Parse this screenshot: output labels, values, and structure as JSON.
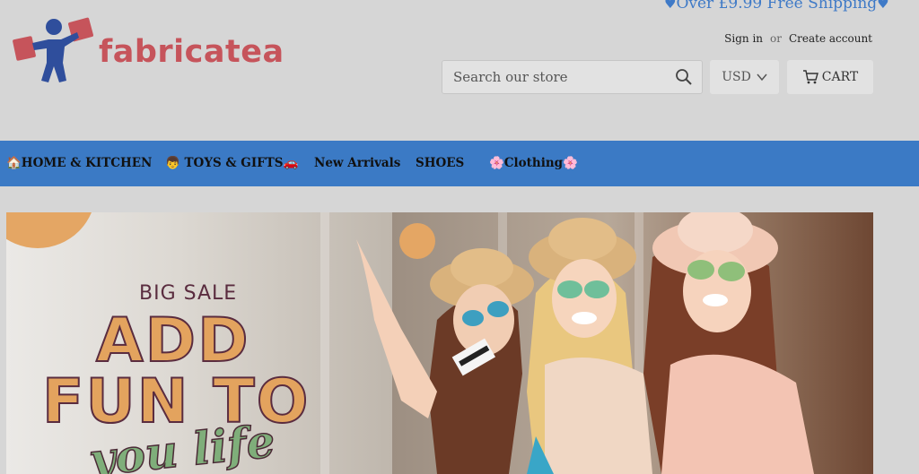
{
  "promo": {
    "text": "Over £9.99 Free Shipping",
    "heart": "♥"
  },
  "brand": {
    "name": "fabricatea"
  },
  "account": {
    "sign_in": "Sign in",
    "or": "or",
    "create": "Create account"
  },
  "search": {
    "placeholder": "Search our store"
  },
  "currency": {
    "selected": "USD"
  },
  "cart": {
    "label": "CART"
  },
  "nav": {
    "items": [
      {
        "label": "🏠HOME & KITCHEN"
      },
      {
        "label": "👦 TOYS & GIFTS🚗"
      },
      {
        "label": "New Arrivals"
      },
      {
        "label": "SHOES"
      },
      {
        "label": "🌸Clothing🌸"
      }
    ]
  },
  "hero": {
    "kicker": "BIG SALE",
    "line1": "ADD",
    "line2": "FUN TO",
    "line3": "you life"
  },
  "colors": {
    "nav_bg": "#3b7ac5",
    "brand": "#c6545b",
    "accent_orange": "#e4a664",
    "promo": "#3f7ac7"
  }
}
